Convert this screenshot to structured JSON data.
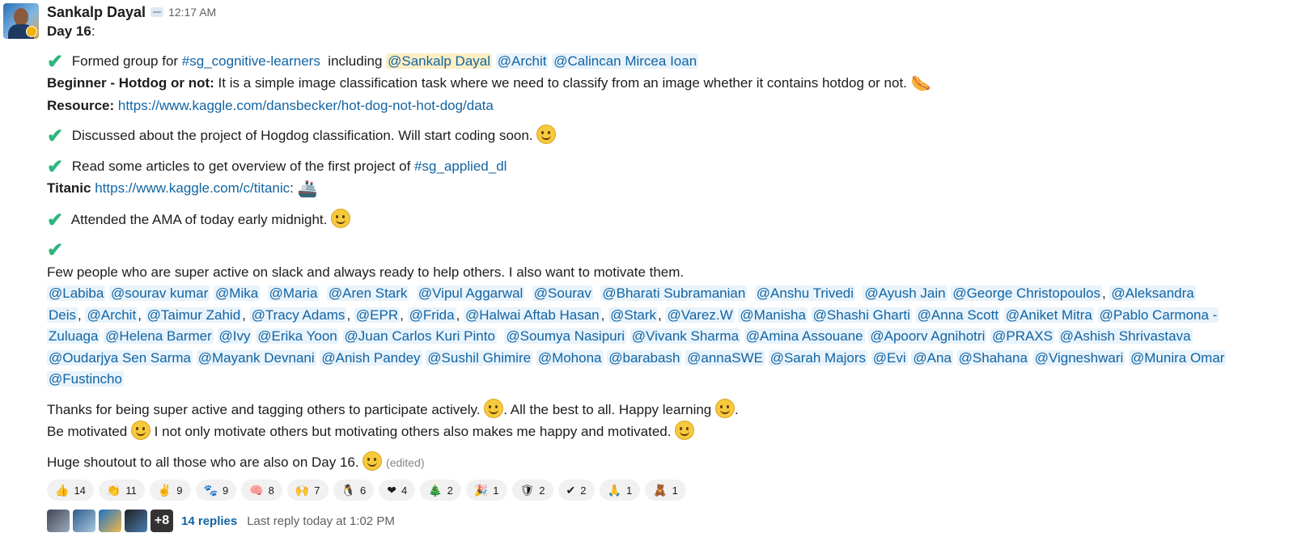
{
  "author": {
    "name": "Sankalp Dayal",
    "time": "12:17 AM"
  },
  "day_title": "Day 16",
  "day_colon": ":",
  "blocks": {
    "b1_text": "Formed group for ",
    "b1_channel": "#sg_cognitive-learners",
    "b1_including": "  including ",
    "b1_mentions": [
      "@Sankalp Dayal",
      "@Archit",
      "@Calincan Mircea Ioan"
    ],
    "b1_beginner_label": "Beginner - Hotdog or not:",
    "b1_beginner_text": " It is a simple image classification task where we need to classify from an image whether it contains hotdog or not. ",
    "b1_resource_label": "Resource:",
    "b1_resource_link": "https://www.kaggle.com/dansbecker/hot-dog-not-hot-dog/data",
    "b2_text": "Discussed about the project of Hogdog classification. Will start coding soon. ",
    "b3_text": "Read some articles to get overview of the first project of ",
    "b3_channel": "#sg_applied_dl",
    "b3_titanic_label": "Titanic",
    "b3_titanic_link": "https://www.kaggle.com/c/titanic",
    "b3_colon": ":",
    "b4_text": "Attended the AMA of today early midnight. ",
    "b5_text": "Few people who are super active on slack and always ready to help others. I also want to motivate them.",
    "b6_line1": "Thanks for being super active and tagging others to participate actively. ",
    "b6_line1b": ". All the best to all. Happy learning ",
    "b6_line1c": ".",
    "b6_line2a": "Be motivated ",
    "b6_line2b": " I not only motivate others but motivating others also makes me happy and motivated. ",
    "b7_text": "Huge shoutout to all those who are also on Day 16. ",
    "edited": "(edited)"
  },
  "mention_lines": [
    [
      [
        "@Labiba",
        " "
      ],
      [
        "@sourav kumar",
        " "
      ],
      [
        "@Mika",
        "  "
      ],
      [
        "@Maria",
        "  "
      ],
      [
        "@Aren Stark",
        "  "
      ],
      [
        "@Vipul Aggarwal",
        "  "
      ],
      [
        "@Sourav",
        "  "
      ],
      [
        "@Bharati Subramanian",
        "  "
      ],
      [
        "@Anshu Trivedi",
        "  "
      ],
      [
        "@Ayush Jain",
        " "
      ],
      [
        "@George Christopoulos",
        ", "
      ],
      [
        "@Aleksandra",
        ""
      ]
    ],
    [
      [
        "Deis",
        ", "
      ],
      [
        "@Archit",
        ", "
      ],
      [
        "@Taimur Zahid",
        ", "
      ],
      [
        "@Tracy Adams",
        ", "
      ],
      [
        "@EPR",
        ", "
      ],
      [
        "@Frida",
        ", "
      ],
      [
        "@Halwai Aftab Hasan",
        ", "
      ],
      [
        "@Stark",
        ", "
      ],
      [
        "@Varez.W",
        " "
      ],
      [
        "@Manisha",
        " "
      ],
      [
        "@Shashi Gharti",
        " "
      ],
      [
        "@Anna Scott",
        " "
      ],
      [
        "@Aniket Mitra",
        " "
      ],
      [
        "@Pablo Carmona -",
        ""
      ]
    ],
    [
      [
        "Zuluaga",
        " "
      ],
      [
        "@Helena Barmer",
        " "
      ],
      [
        "@Ivy",
        " "
      ],
      [
        "@Erika Yoon",
        " "
      ],
      [
        "@Juan Carlos Kuri Pinto",
        "  "
      ],
      [
        "@Soumya Nasipuri",
        " "
      ],
      [
        "@Vivank Sharma",
        " "
      ],
      [
        "@Amina Assouane",
        " "
      ],
      [
        "@Apoorv Agnihotri",
        " "
      ],
      [
        "@PRAXS",
        " "
      ],
      [
        "@Ashish Shrivastava",
        ""
      ]
    ],
    [
      [
        "@Oudarjya Sen Sarma",
        " "
      ],
      [
        "@Mayank Devnani",
        " "
      ],
      [
        "@Anish Pandey",
        " "
      ],
      [
        "@Sushil Ghimire",
        " "
      ],
      [
        "@Mohona",
        " "
      ],
      [
        "@barabash",
        " "
      ],
      [
        "@annaSWE",
        " "
      ],
      [
        "@Sarah Majors",
        " "
      ],
      [
        "@Evi",
        " "
      ],
      [
        "@Ana",
        " "
      ],
      [
        "@Shahana",
        " "
      ],
      [
        "@Vigneshwari",
        " "
      ],
      [
        "@Munira Omar",
        ""
      ]
    ],
    [
      [
        "@Fustincho",
        ""
      ]
    ]
  ],
  "reactions": [
    {
      "emoji": "👍",
      "count": "14"
    },
    {
      "emoji": "👏",
      "count": "11"
    },
    {
      "emoji": "✌",
      "count": "9"
    },
    {
      "emoji": "🐾",
      "count": "9"
    },
    {
      "emoji": "🧠",
      "count": "8"
    },
    {
      "emoji": "🙌",
      "count": "7"
    },
    {
      "emoji": "🐧",
      "count": "6"
    },
    {
      "emoji": "❤",
      "count": "4"
    },
    {
      "emoji": "🎄",
      "count": "2"
    },
    {
      "emoji": "🎉",
      "count": "1"
    },
    {
      "emoji": "🛡",
      "count": "2"
    },
    {
      "emoji": "✔",
      "count": "2"
    },
    {
      "emoji": "🙏",
      "count": "1"
    },
    {
      "emoji": "🧸",
      "count": "1"
    }
  ],
  "thread": {
    "more": "+8",
    "replies": "14 replies",
    "last_reply": "Last reply today at 1:02 PM"
  },
  "colors": {
    "link": "#1264a3",
    "check": "#2eb67d",
    "mention_bg": "#e8f3fb"
  }
}
